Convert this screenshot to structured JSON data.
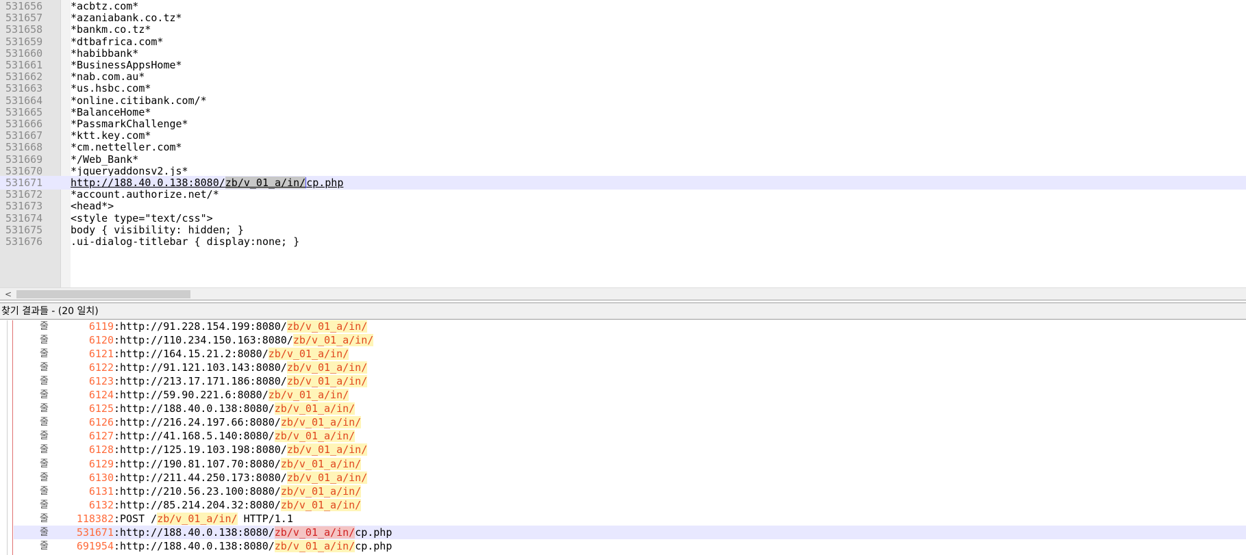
{
  "editor": {
    "lines": [
      {
        "num": "531656",
        "text": "*acbtz.com*"
      },
      {
        "num": "531657",
        "text": "*azaniabank.co.tz*"
      },
      {
        "num": "531658",
        "text": "*bankm.co.tz*"
      },
      {
        "num": "531659",
        "text": "*dtbafrica.com*"
      },
      {
        "num": "531660",
        "text": "*habibbank*"
      },
      {
        "num": "531661",
        "text": "*BusinessAppsHome*"
      },
      {
        "num": "531662",
        "text": "*nab.com.au*"
      },
      {
        "num": "531663",
        "text": "*us.hsbc.com*"
      },
      {
        "num": "531664",
        "text": "*online.citibank.com/*"
      },
      {
        "num": "531665",
        "text": "*BalanceHome*"
      },
      {
        "num": "531666",
        "text": "*PassmarkChallenge*"
      },
      {
        "num": "531667",
        "text": "*ktt.key.com*"
      },
      {
        "num": "531668",
        "text": "*cm.netteller.com*"
      },
      {
        "num": "531669",
        "text": "*/Web_Bank*"
      },
      {
        "num": "531670",
        "text": "*jqueryaddonsv2.js*"
      },
      {
        "num": "531671",
        "text_before": "http://188.40.0.138:8080/",
        "text_selected": "zb/v_01_a/in/",
        "text_after": "cp.php",
        "current": true
      },
      {
        "num": "531672",
        "text": "*account.authorize.net/*"
      },
      {
        "num": "531673",
        "text": "<head*>"
      },
      {
        "num": "531674",
        "text": "<style type=\"text/css\">"
      },
      {
        "num": "531675",
        "text": "body { visibility: hidden; }"
      },
      {
        "num": "531676",
        "text": ".ui-dialog-titlebar { display:none; }"
      }
    ]
  },
  "scrollbar": {
    "left_arrow": "<"
  },
  "results_panel": {
    "header": "찾기 결과들 - (20 일치)",
    "line_prefix": "줄",
    "lines": [
      {
        "num": "6119",
        "before": "http://91.228.154.199:8080/",
        "hit": "zb/v_01_a/in/",
        "after": ""
      },
      {
        "num": "6120",
        "before": "http://110.234.150.163:8080/",
        "hit": "zb/v_01_a/in/",
        "after": ""
      },
      {
        "num": "6121",
        "before": "http://164.15.21.2:8080/",
        "hit": "zb/v_01_a/in/",
        "after": ""
      },
      {
        "num": "6122",
        "before": "http://91.121.103.143:8080/",
        "hit": "zb/v_01_a/in/",
        "after": ""
      },
      {
        "num": "6123",
        "before": "http://213.17.171.186:8080/",
        "hit": "zb/v_01_a/in/",
        "after": ""
      },
      {
        "num": "6124",
        "before": "http://59.90.221.6:8080/",
        "hit": "zb/v_01_a/in/",
        "after": ""
      },
      {
        "num": "6125",
        "before": "http://188.40.0.138:8080/",
        "hit": "zb/v_01_a/in/",
        "after": ""
      },
      {
        "num": "6126",
        "before": "http://216.24.197.66:8080/",
        "hit": "zb/v_01_a/in/",
        "after": ""
      },
      {
        "num": "6127",
        "before": "http://41.168.5.140:8080/",
        "hit": "zb/v_01_a/in/",
        "after": ""
      },
      {
        "num": "6128",
        "before": "http://125.19.103.198:8080/",
        "hit": "zb/v_01_a/in/",
        "after": ""
      },
      {
        "num": "6129",
        "before": "http://190.81.107.70:8080/",
        "hit": "zb/v_01_a/in/",
        "after": ""
      },
      {
        "num": "6130",
        "before": "http://211.44.250.173:8080/",
        "hit": "zb/v_01_a/in/",
        "after": ""
      },
      {
        "num": "6131",
        "before": "http://210.56.23.100:8080/",
        "hit": "zb/v_01_a/in/",
        "after": ""
      },
      {
        "num": "6132",
        "before": "http://85.214.204.32:8080/",
        "hit": "zb/v_01_a/in/",
        "after": ""
      },
      {
        "num": "118382",
        "before": "POST /",
        "hit": "zb/v_01_a/in/",
        "after": " HTTP/1.1"
      },
      {
        "num": "531671",
        "before": "http://188.40.0.138:8080/",
        "hit": "zb/v_01_a/in/",
        "after": "cp.php",
        "current": true
      },
      {
        "num": "691954",
        "before": "http://188.40.0.138:8080/",
        "hit": "zb/v_01_a/in/",
        "after": "cp.php"
      }
    ]
  },
  "colors": {
    "current_line": "#e8e8ff",
    "line_number_hit": "#ff6a3a",
    "hit_background": "#fff5b8",
    "hit_text": "#e0461e"
  }
}
